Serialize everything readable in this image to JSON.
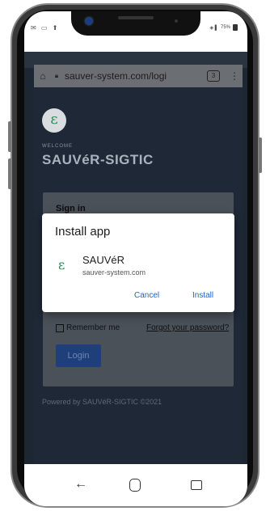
{
  "status_bar": {
    "left_icons": "✉ ▭ ⬆",
    "signal_icons": "◈ ▌",
    "battery_pct": "75%"
  },
  "browser": {
    "url": "sauver-system.com/logi",
    "tab_count": "3",
    "home_icon": "home-icon",
    "lock_icon": "lock-icon",
    "menu_icon": "more-vert-icon"
  },
  "page": {
    "logo_glyph": "ε",
    "welcome": "WELCOME",
    "brand": "SAUVéR-SIGTIC",
    "signin_title": "Sign in",
    "remember_label": "Remember me",
    "forgot_link": "Forgot your password?",
    "login_button": "Login",
    "footer": "Powered by SAUVéR-SIGTIC ©2021"
  },
  "install_dialog": {
    "title": "Install app",
    "app_logo_glyph": "ε",
    "app_name": "SAUVéR",
    "app_url": "sauver-system.com",
    "cancel_label": "Cancel",
    "install_label": "Install"
  },
  "nav": {
    "back_glyph": "←",
    "back_icon": "back-arrow-icon",
    "home_icon": "home-circle-icon",
    "recents_icon": "recents-icon"
  },
  "colors": {
    "accent": "#1a62d0",
    "logo_green": "#2e8b57",
    "page_bg": "#1e2836"
  }
}
